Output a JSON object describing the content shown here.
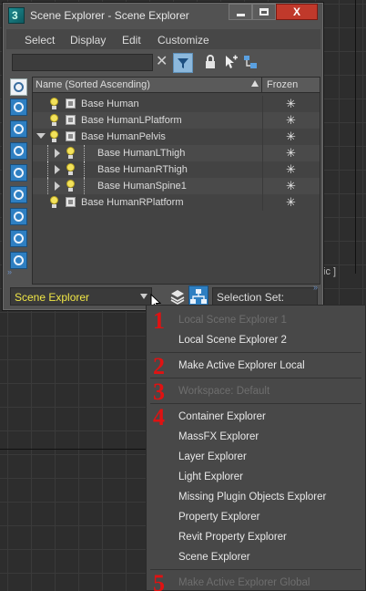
{
  "window": {
    "title": "Scene Explorer - Scene Explorer",
    "close_label": "X"
  },
  "menu": {
    "items": [
      "Select",
      "Display",
      "Edit",
      "Customize"
    ]
  },
  "search": {
    "value": "",
    "placeholder": ""
  },
  "grid": {
    "columns": {
      "name": "Name (Sorted Ascending)",
      "frozen": "Frozen"
    },
    "rows": [
      {
        "name": "Base Human",
        "depth": 0,
        "expander": "none",
        "frozen_icon": "snowflake-icon"
      },
      {
        "name": "Base HumanLPlatform",
        "depth": 0,
        "expander": "none",
        "frozen_icon": "snowflake-icon"
      },
      {
        "name": "Base HumanPelvis",
        "depth": 0,
        "expander": "expanded",
        "frozen_icon": "snowflake-icon"
      },
      {
        "name": "Base HumanLThigh",
        "depth": 1,
        "expander": "collapsed",
        "frozen_icon": "snowflake-icon"
      },
      {
        "name": "Base HumanRThigh",
        "depth": 1,
        "expander": "collapsed",
        "frozen_icon": "snowflake-icon"
      },
      {
        "name": "Base HumanSpine1",
        "depth": 1,
        "expander": "collapsed",
        "frozen_icon": "snowflake-icon"
      },
      {
        "name": "Base HumanRPlatform",
        "depth": 0,
        "expander": "none",
        "frozen_icon": "snowflake-icon"
      }
    ]
  },
  "bottom": {
    "explorer_select": "Scene Explorer",
    "selection_set_label": "Selection Set:"
  },
  "background": {
    "fragment_text": "tic ]"
  },
  "context_menu": {
    "markers": [
      "1",
      "2",
      "3",
      "4",
      "5"
    ],
    "groups": [
      {
        "items": [
          {
            "label": "Local Scene Explorer 1",
            "enabled": false
          },
          {
            "label": "Local Scene Explorer 2",
            "enabled": true
          }
        ]
      },
      {
        "items": [
          {
            "label": "Make Active Explorer Local",
            "enabled": true
          }
        ]
      },
      {
        "items": [
          {
            "label": "Workspace: Default",
            "enabled": false
          }
        ]
      },
      {
        "items": [
          {
            "label": "Container Explorer",
            "enabled": true
          },
          {
            "label": "MassFX Explorer",
            "enabled": true
          },
          {
            "label": "Layer Explorer",
            "enabled": true
          },
          {
            "label": "Light Explorer",
            "enabled": true
          },
          {
            "label": "Missing Plugin Objects Explorer",
            "enabled": true
          },
          {
            "label": "Property Explorer",
            "enabled": true
          },
          {
            "label": "Revit Property Explorer",
            "enabled": true
          },
          {
            "label": "Scene Explorer",
            "enabled": true
          }
        ]
      },
      {
        "items": [
          {
            "label": "Make Active Explorer Global",
            "enabled": false
          }
        ]
      }
    ]
  },
  "colors": {
    "accent_blue": "#2e7fc2",
    "explorer_label_yellow": "#f0e646",
    "marker_red": "#e01212",
    "close_red": "#c0392b"
  }
}
